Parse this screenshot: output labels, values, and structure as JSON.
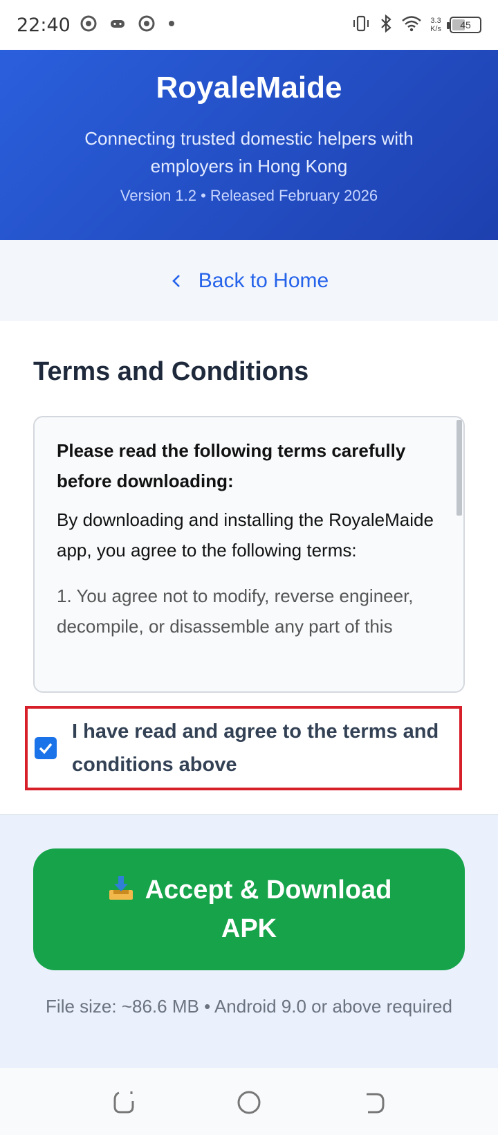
{
  "status_bar": {
    "time": "22:40",
    "net_speed_value": "3.3",
    "net_speed_unit": "K/s",
    "battery_level": "45"
  },
  "header": {
    "title": "RoyaleMaide",
    "tagline": "Connecting trusted domestic helpers with employers in Hong Kong",
    "version": "Version 1.2 • Released February 2026",
    "background_color": "#1e40af"
  },
  "nav": {
    "back_label": "Back to Home"
  },
  "terms": {
    "heading": "Terms and Conditions",
    "lead": "Please read the following terms carefully before downloading:",
    "intro": "By downloading and installing the RoyaleMaide app, you agree to the following terms:",
    "item_1": "1. You agree not to modify, reverse engineer, decompile, or disassemble any part of this"
  },
  "agreement": {
    "checked": true,
    "label": "I have read and agree to the terms and conditions above"
  },
  "download": {
    "button_label": "Accept & Download APK",
    "button_color": "#16a34a",
    "file_info": "File size: ~86.6 MB • Android 9.0 or above required"
  },
  "colors": {
    "accent": "#2563eb",
    "highlight_border": "#d71f2a"
  }
}
